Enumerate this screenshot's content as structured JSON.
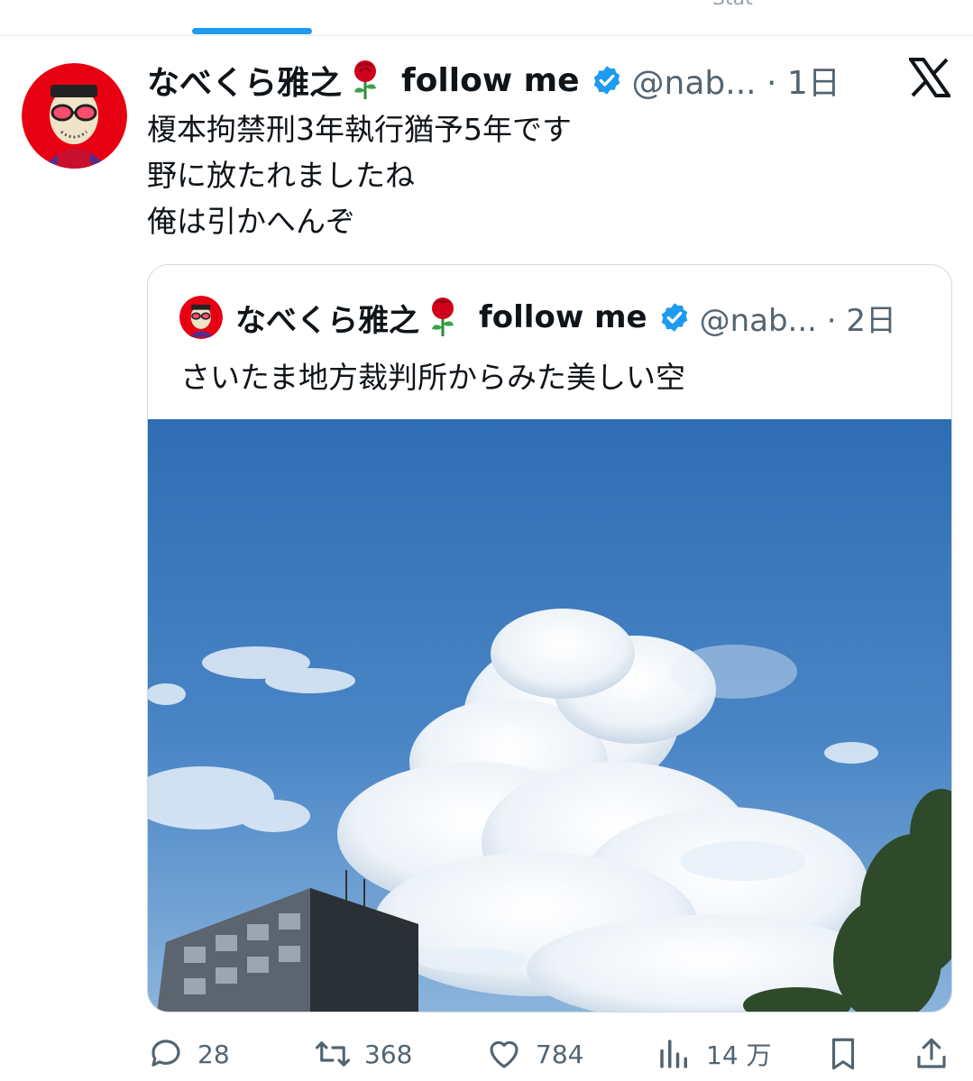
{
  "tab": {
    "partial_text": "Stat"
  },
  "tweet": {
    "author_name": "なべくら雅之",
    "follow_label": "follow me",
    "handle_time": "@nab... · 1日",
    "lines": [
      "榎本拘禁刑3年執行猶予5年です",
      "野に放たれましたね",
      "俺は引かへんぞ"
    ]
  },
  "quote": {
    "author_name": "なべくら雅之",
    "follow_label": "follow me",
    "handle_time": "@nab... · 2日",
    "text": "さいたま地方裁判所からみた美しい空"
  },
  "actions": {
    "reply_count": "28",
    "retweet_count": "368",
    "like_count": "784",
    "views_count": "14 万"
  },
  "icons": {
    "reply": "reply-icon",
    "retweet": "retweet-icon",
    "like": "heart-icon",
    "views": "views-icon",
    "bookmark": "bookmark-icon",
    "share": "share-icon",
    "x": "x-logo-icon",
    "verified": "verified-badge-icon",
    "rose": "rose-emoji"
  },
  "colors": {
    "accent": "#1d9bf0",
    "text": "#0f1419",
    "muted": "#536471",
    "border": "#cfd9de"
  }
}
